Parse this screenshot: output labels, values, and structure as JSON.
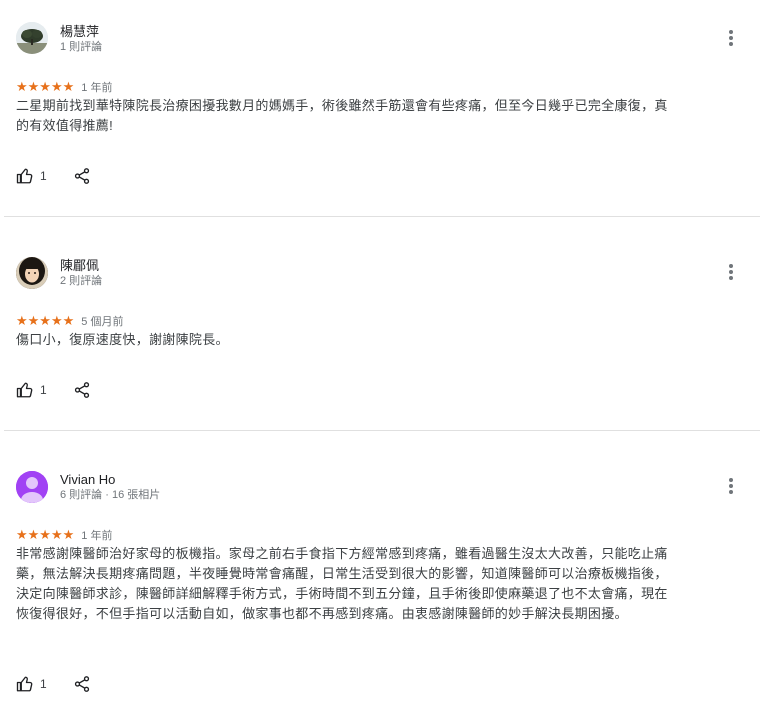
{
  "reviews": [
    {
      "name": "楊慧萍",
      "meta": "1 則評論",
      "stars": "★★★★★",
      "ago": "1 年前",
      "text": "二星期前找到華特陳院長治療困擾我數月的媽媽手，術後雖然手筋還會有些疼痛，但至今日幾乎已完全康復，真的有效值得推薦!",
      "likes": "1"
    },
    {
      "name": "陳郿佩",
      "meta": "2 則評論",
      "stars": "★★★★★",
      "ago": "5 個月前",
      "text": "傷口小，復原速度快，謝謝陳院長。",
      "likes": "1"
    },
    {
      "name": "Vivian Ho",
      "meta": "6 則評論 · 16 張相片",
      "stars": "★★★★★",
      "ago": "1 年前",
      "text": "非常感謝陳醫師治好家母的板機指。家母之前右手食指下方經常感到疼痛，雖看過醫生沒太大改善，只能吃止痛藥，無法解決長期疼痛問題，半夜睡覺時常會痛醒，日常生活受到很大的影響，知道陳醫師可以治療板機指後，決定向陳醫師求診，陳醫師詳細解釋手術方式，手術時間不到五分鐘，且手術後即使麻藥退了也不太會痛，現在恢復得很好，不但手指可以活動自如，做家事也都不再感到疼痛。由衷感謝陳醫師的妙手解決長期困擾。",
      "likes": "1"
    }
  ],
  "colors": {
    "star": "#e7711b",
    "purple_avatar": "#a142f4"
  },
  "icons": [
    "thumb-up-icon",
    "share-icon",
    "more-vert-icon"
  ]
}
